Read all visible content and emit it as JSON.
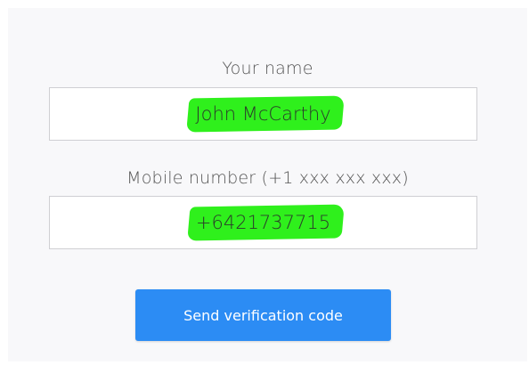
{
  "form": {
    "name_label": "Your name",
    "name_value": "John McCarthy",
    "mobile_label": "Mobile number (+1 xxx xxx xxx)",
    "mobile_value": "+6421737715",
    "submit_label": "Send verification code"
  },
  "colors": {
    "accent": "#2c8cf4",
    "highlight": "#2ff01c",
    "panel_background": "#f8f8fa"
  }
}
